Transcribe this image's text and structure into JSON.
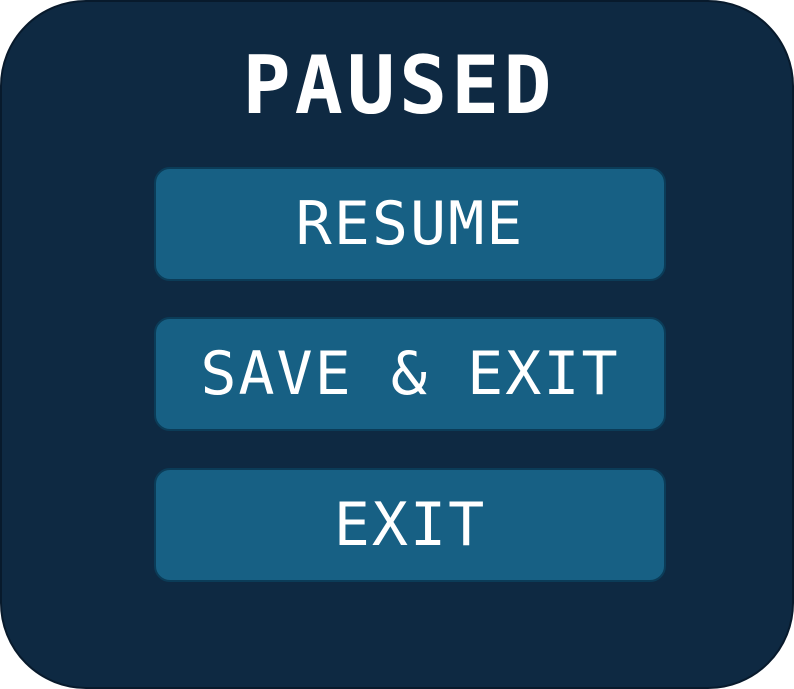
{
  "pause_menu": {
    "title": "PAUSED",
    "buttons": [
      {
        "label": "RESUME"
      },
      {
        "label": "SAVE & EXIT"
      },
      {
        "label": "EXIT"
      }
    ]
  },
  "colors": {
    "panel_background": "#0e2942",
    "button_background": "#176084",
    "text": "#ffffff"
  }
}
